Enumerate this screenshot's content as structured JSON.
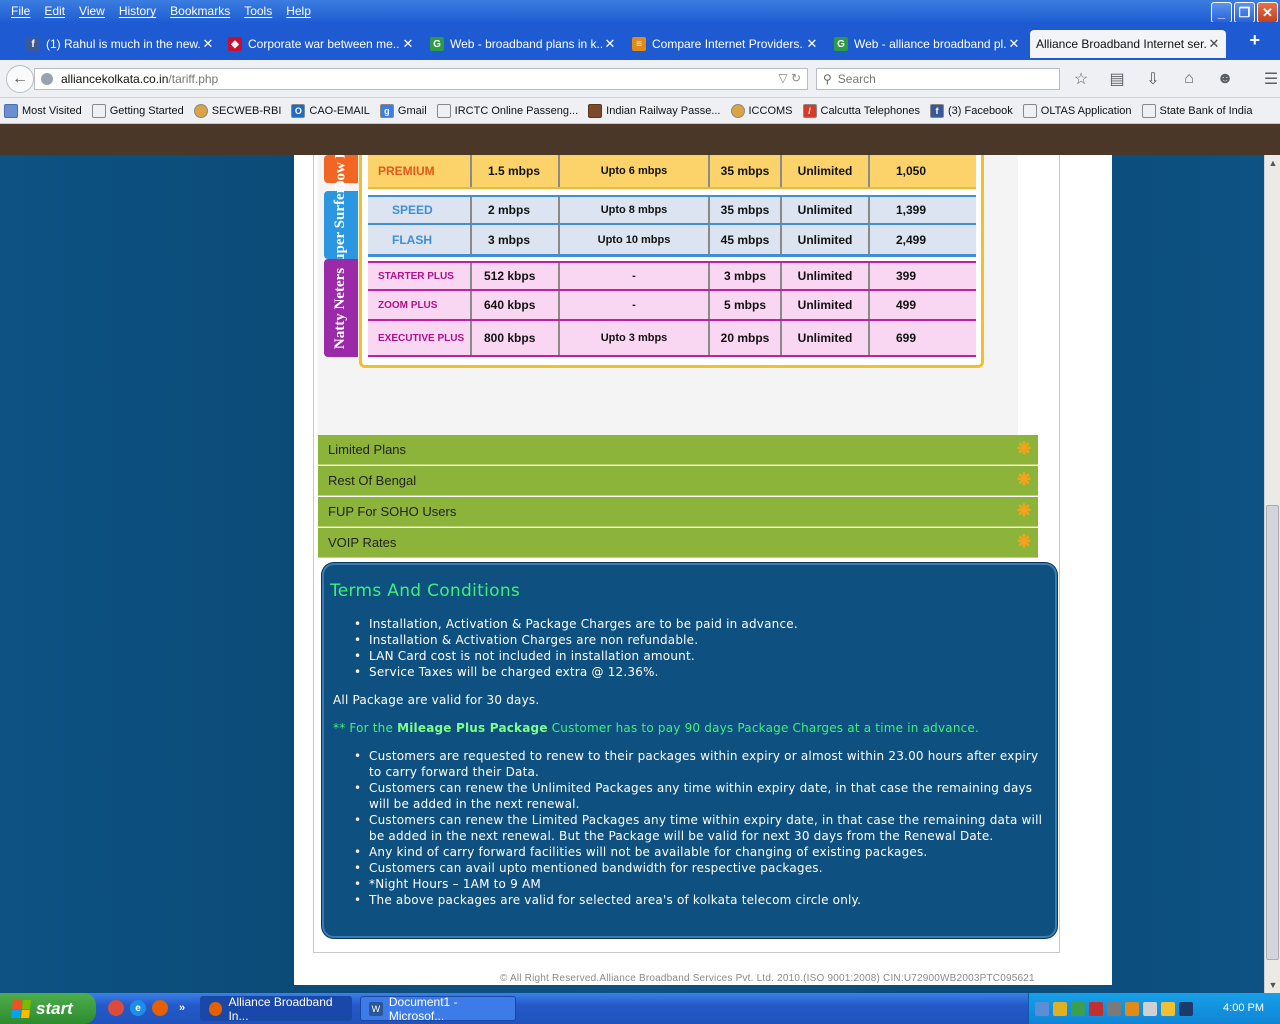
{
  "menu": [
    "File",
    "Edit",
    "View",
    "History",
    "Bookmarks",
    "Tools",
    "Help"
  ],
  "window_buttons": {
    "minimize": "_",
    "maximize": "❐",
    "close": "✕"
  },
  "tabs": [
    {
      "title": "(1) Rahul is much in the new...",
      "icon": "facebook-icon",
      "close": "✕"
    },
    {
      "title": "Corporate war between me...",
      "icon": "news-icon",
      "close": "✕"
    },
    {
      "title": "Web - broadband plans in k...",
      "icon": "google-icon",
      "close": "✕"
    },
    {
      "title": "Compare Internet Providers...",
      "icon": "compare-icon",
      "close": "✕"
    },
    {
      "title": "Web - alliance broadband pl...",
      "icon": "google-icon",
      "close": "✕"
    },
    {
      "title": "Alliance Broadband Internet ser...",
      "icon": "none",
      "close": "✕"
    }
  ],
  "new_tab": "+",
  "url": {
    "host": "alliancekolkata.co.in",
    "path": "/tariff.php"
  },
  "search": {
    "placeholder": "Search"
  },
  "bookmarks": [
    {
      "label": "Most Visited",
      "icon": "folder-icon"
    },
    {
      "label": "Getting Started",
      "icon": "page-icon"
    },
    {
      "label": "SECWEB-RBI",
      "icon": "rbi-icon"
    },
    {
      "label": "CAO-EMAIL",
      "icon": "outlook-icon"
    },
    {
      "label": "Gmail",
      "icon": "google-icon"
    },
    {
      "label": "IRCTC Online Passeng...",
      "icon": "page-icon"
    },
    {
      "label": "Indian Railway Passe...",
      "icon": "railway-icon"
    },
    {
      "label": "ICCOMS",
      "icon": "iccoms-icon"
    },
    {
      "label": "Calcutta Telephones",
      "icon": "bsnl-icon"
    },
    {
      "label": "(3) Facebook",
      "icon": "facebook-icon"
    },
    {
      "label": "OLTAS Application",
      "icon": "page-icon"
    },
    {
      "label": "State Bank of India",
      "icon": "page-icon"
    }
  ],
  "tariff": {
    "categories": [
      {
        "label": "Dow D",
        "color": "#f26522"
      },
      {
        "label": "Super Surfers",
        "color": "#2b97e0"
      },
      {
        "label": "Natty Neters",
        "color": "#9b2aa8"
      }
    ],
    "rows": [
      {
        "plan": "PREMIUM",
        "speed": "1.5 mbps",
        "night": "Upto 6 mbps",
        "burst": "35 mbps",
        "usage": "Unlimited",
        "price": "1,050",
        "group": "premium"
      },
      {
        "plan": "SPEED",
        "speed": "2 mbps",
        "night": "Upto 8 mbps",
        "burst": "35 mbps",
        "usage": "Unlimited",
        "price": "1,399",
        "group": "surfers"
      },
      {
        "plan": "FLASH",
        "speed": "3 mbps",
        "night": "Upto 10 mbps",
        "burst": "45 mbps",
        "usage": "Unlimited",
        "price": "2,499",
        "group": "surfers"
      },
      {
        "plan": "STARTER PLUS",
        "speed": "512 kbps",
        "night": "-",
        "burst": "3 mbps",
        "usage": "Unlimited",
        "price": "399",
        "group": "natty"
      },
      {
        "plan": "ZOOM PLUS",
        "speed": "640 kbps",
        "night": "-",
        "burst": "5 mbps",
        "usage": "Unlimited",
        "price": "499",
        "group": "natty"
      },
      {
        "plan": "EXECUTIVE PLUS",
        "speed": "800 kbps",
        "night": "Upto 3 mbps",
        "burst": "20 mbps",
        "usage": "Unlimited",
        "price": "699",
        "group": "natty"
      }
    ]
  },
  "accordion": [
    "Limited Plans",
    "Rest Of Bengal",
    "FUP For SOHO Users",
    "VOIP Rates"
  ],
  "terms": {
    "title": "Terms And Conditions",
    "list1": [
      "Installation, Activation & Package Charges are to be paid in advance.",
      "Installation & Activation Charges are non refundable.",
      "LAN Card cost is not included in installation amount.",
      "Service Taxes will be charged extra @ 12.36%."
    ],
    "validity": "All Package are valid for 30 days.",
    "mileage_prefix": "** For the ",
    "mileage_bold": "Mileage Plus Package",
    "mileage_suffix": " Customer has to pay 90 days Package Charges at a time in advance.",
    "list2": [
      "Customers are requested to renew to their packages within expiry or almost within 23.00 hours after expiry to carry forward their Data.",
      "Customers can renew the Unlimited Packages any time within expiry date, in that case the remaining days will be added in the next renewal.",
      "Customers can renew the Limited Packages any time within expiry date, in that case the remaining data will be added in the next renewal. But the Package will be valid for next 30 days from the Renewal Date.",
      "Any kind of carry forward facilities will not be available for changing of existing packages.",
      "Customers can avail upto mentioned bandwidth for respective packages.",
      "*Night Hours – 1AM to 9 AM",
      "The above packages are valid for selected area's of kolkata telecom circle only."
    ]
  },
  "copyright": "© All Right Reserved.Alliance Broadband Services Pvt. Ltd. 2010.(ISO 9001:2008) CIN:U72900WB2003PTC095621",
  "taskbar": {
    "start": "start",
    "tasks": [
      {
        "label": "Alliance Broadband In...",
        "icon": "firefox-icon"
      },
      {
        "label": "Document1 - Microsof...",
        "icon": "word-icon"
      }
    ],
    "clock": "4:00 PM"
  }
}
